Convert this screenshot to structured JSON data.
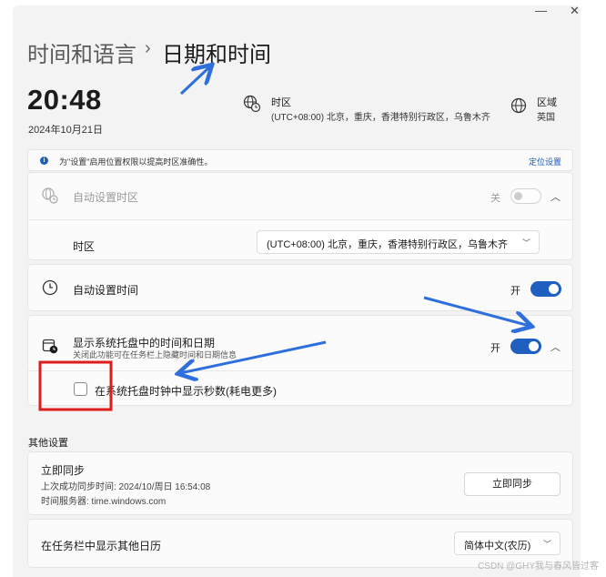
{
  "window": {
    "minimize": "—",
    "close": "✕"
  },
  "breadcrumb": {
    "parent": "时间和语言",
    "separator": "›",
    "current": "日期和时间"
  },
  "clock": {
    "time": "20:48",
    "date": "2024年10月21日"
  },
  "timezone_info": {
    "label": "时区",
    "value": "(UTC+08:00) 北京，重庆，香港特别行政区，乌鲁木齐"
  },
  "region_info": {
    "label": "区域",
    "value": "英国"
  },
  "banner": {
    "text": "为\"设置\"启用位置权限以提高时区准确性。",
    "link": "定位设置",
    "icon": "info-icon"
  },
  "auto_timezone": {
    "title": "自动设置时区",
    "toggle_label": "关",
    "icon": "globe-clock-icon"
  },
  "timezone_row": {
    "title": "时区",
    "selected": "(UTC+08:00) 北京，重庆，香港特别行政区，乌鲁木齐"
  },
  "auto_time": {
    "title": "自动设置时间",
    "toggle_label": "开",
    "icon": "clock-icon"
  },
  "tray": {
    "title": "显示系统托盘中的时间和日期",
    "subtitle": "关闭此功能可在任务栏上隐藏时间和日期信息",
    "toggle_label": "开",
    "icon": "calendar-clock-icon",
    "seconds_option": "在系统托盘时钟中显示秒数(耗电更多)"
  },
  "other_settings": {
    "heading": "其他设置",
    "sync": {
      "title": "立即同步",
      "last_sync": "上次成功同步时间: 2024/10/周日 16:54:08",
      "server": "时间服务器: time.windows.com",
      "button": "立即同步"
    },
    "calendar": {
      "title": "在任务栏中显示其他日历",
      "selected": "简体中文(农历)"
    }
  },
  "watermark": "CSDN @GHY我与春风皆过客",
  "colors": {
    "accent": "#1f5fbf",
    "annotation_arrow": "#2f6fdc",
    "highlight_box": "#e01b1b"
  }
}
